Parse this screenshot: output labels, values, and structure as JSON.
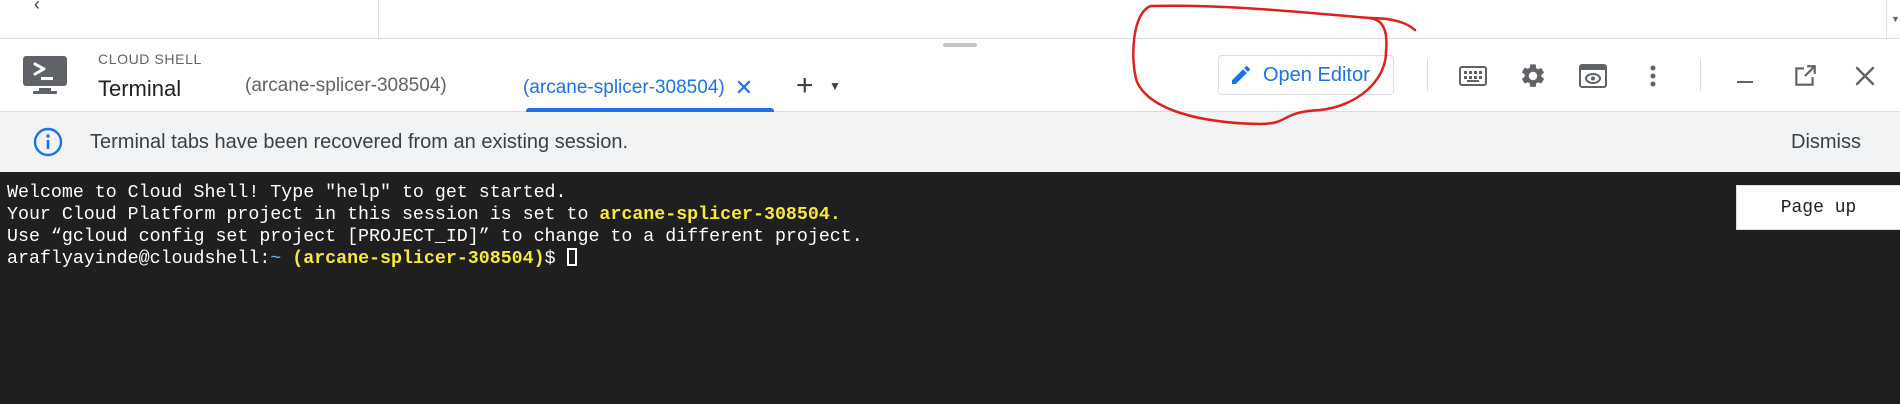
{
  "header": {
    "eyebrow": "CLOUD SHELL",
    "title": "Terminal",
    "tabs": [
      {
        "label": "(arcane-splicer-308504)",
        "active": false
      },
      {
        "label": "(arcane-splicer-308504)",
        "active": true
      }
    ],
    "open_editor_label": "Open Editor",
    "icons": [
      "keyboard-icon",
      "settings-gear-icon",
      "web-preview-icon",
      "more-vert-icon",
      "minimize-icon",
      "open-in-new-window-icon",
      "close-icon"
    ]
  },
  "banner": {
    "message": "Terminal tabs have been recovered from an existing session.",
    "dismiss_label": "Dismiss"
  },
  "terminal": {
    "line1": "Welcome to Cloud Shell! Type \"help\" to get started.",
    "line2_prefix": "Your Cloud Platform project in this session is set to ",
    "line2_project": "arcane-splicer-308504",
    "line2_suffix": ".",
    "line3": "Use “gcloud config set project [PROJECT_ID]” to change to a different project.",
    "prompt_user": "araflyayinde@cloudshell:",
    "prompt_dir": "~",
    "prompt_project": "(arcane-splicer-308504)",
    "prompt_symbol": "$ "
  },
  "page_up_label": "Page up",
  "colors": {
    "accent": "#1a73e8",
    "terminal_bg": "#1f1f1f",
    "terminal_highlight": "#f7e83a",
    "annotation": "#e0201b"
  }
}
